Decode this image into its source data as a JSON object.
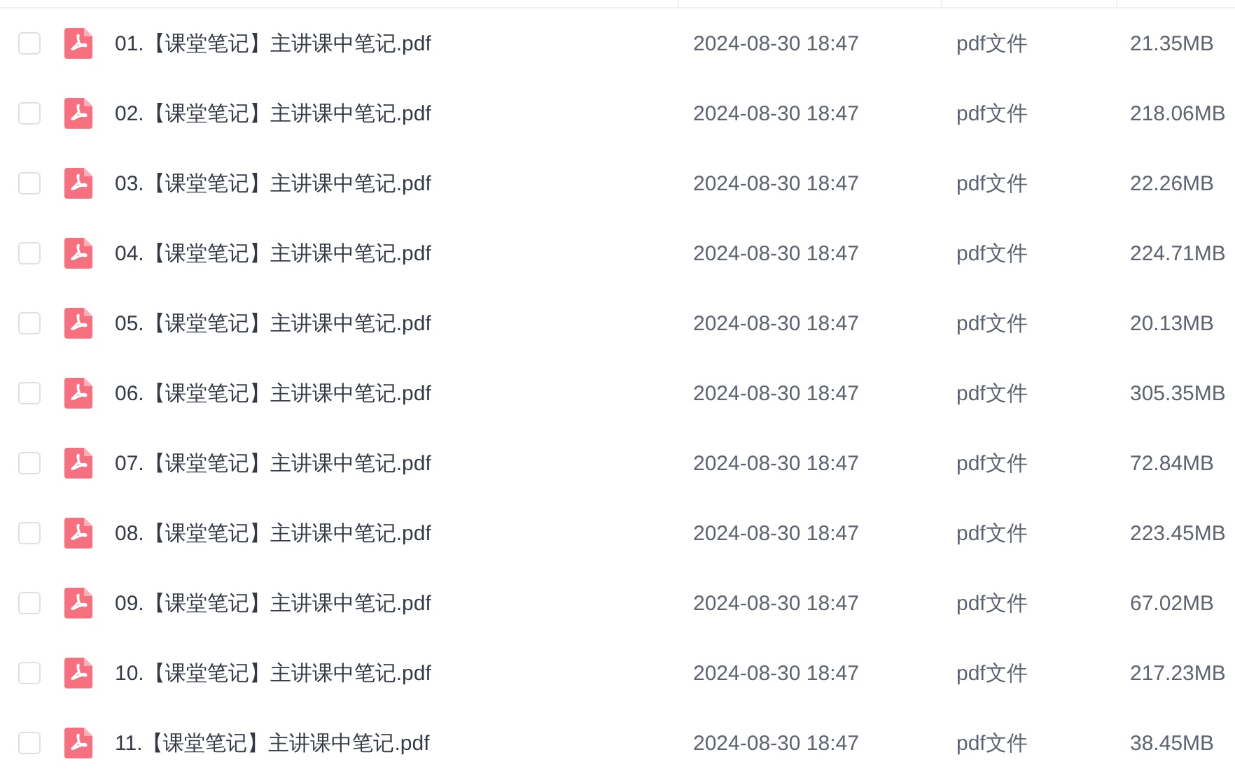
{
  "files": [
    {
      "name": "01.【课堂笔记】主讲课中笔记.pdf",
      "modified": "2024-08-30 18:47",
      "type": "pdf文件",
      "size": "21.35MB",
      "checked": false
    },
    {
      "name": "02.【课堂笔记】主讲课中笔记.pdf",
      "modified": "2024-08-30 18:47",
      "type": "pdf文件",
      "size": "218.06MB",
      "checked": false
    },
    {
      "name": "03.【课堂笔记】主讲课中笔记.pdf",
      "modified": "2024-08-30 18:47",
      "type": "pdf文件",
      "size": "22.26MB",
      "checked": false
    },
    {
      "name": "04.【课堂笔记】主讲课中笔记.pdf",
      "modified": "2024-08-30 18:47",
      "type": "pdf文件",
      "size": "224.71MB",
      "checked": false
    },
    {
      "name": "05.【课堂笔记】主讲课中笔记.pdf",
      "modified": "2024-08-30 18:47",
      "type": "pdf文件",
      "size": "20.13MB",
      "checked": false
    },
    {
      "name": "06.【课堂笔记】主讲课中笔记.pdf",
      "modified": "2024-08-30 18:47",
      "type": "pdf文件",
      "size": "305.35MB",
      "checked": false
    },
    {
      "name": "07.【课堂笔记】主讲课中笔记.pdf",
      "modified": "2024-08-30 18:47",
      "type": "pdf文件",
      "size": "72.84MB",
      "checked": false
    },
    {
      "name": "08.【课堂笔记】主讲课中笔记.pdf",
      "modified": "2024-08-30 18:47",
      "type": "pdf文件",
      "size": "223.45MB",
      "checked": false
    },
    {
      "name": "09.【课堂笔记】主讲课中笔记.pdf",
      "modified": "2024-08-30 18:47",
      "type": "pdf文件",
      "size": "67.02MB",
      "checked": false
    },
    {
      "name": "10.【课堂笔记】主讲课中笔记.pdf",
      "modified": "2024-08-30 18:47",
      "type": "pdf文件",
      "size": "217.23MB",
      "checked": false
    },
    {
      "name": "11.【课堂笔记】主讲课中笔记.pdf",
      "modified": "2024-08-30 18:47",
      "type": "pdf文件",
      "size": "38.45MB",
      "checked": false
    }
  ]
}
